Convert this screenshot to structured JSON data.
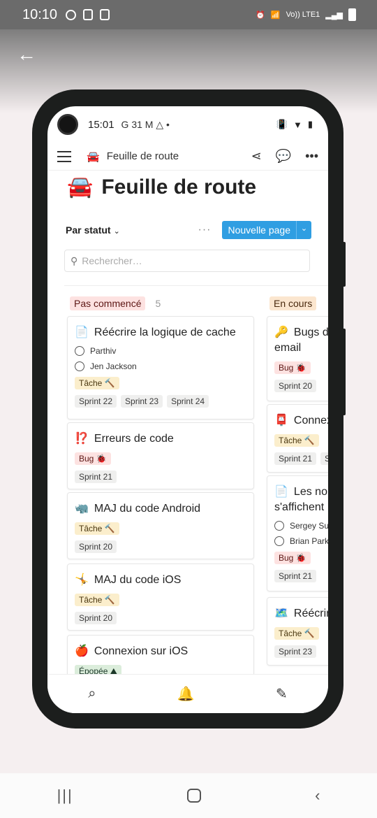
{
  "os_status": {
    "time": "10:10",
    "network": "Vo)) LTE1"
  },
  "app_status": {
    "time": "15:01",
    "icons": "G 31 M △ •"
  },
  "app_bar": {
    "emoji": "🚘",
    "title": "Feuille de route"
  },
  "page": {
    "emoji": "🚘",
    "title": "Feuille de route"
  },
  "toolbar": {
    "group_label": "Par statut",
    "more": "···",
    "new_page": "Nouvelle page"
  },
  "search": {
    "placeholder": "Rechercher…"
  },
  "columns": [
    {
      "label": "Pas commencé",
      "count": "5"
    },
    {
      "label": "En cours"
    }
  ],
  "cards_left": [
    {
      "icon": "📄",
      "title": "Réécrire la logique de cache",
      "people": [
        "Parthiv",
        "Jen Jackson"
      ],
      "type": "Tâche 🔨",
      "sprints": [
        "Sprint 22",
        "Sprint 23",
        "Sprint 24"
      ]
    },
    {
      "icon": "⁉️",
      "title": "Erreurs de code",
      "type": "Bug 🐞",
      "sprints": [
        "Sprint 21"
      ]
    },
    {
      "icon": "🦏",
      "title": "MAJ du code Android",
      "type": "Tâche 🔨",
      "sprints": [
        "Sprint 20"
      ]
    },
    {
      "icon": "🤸",
      "title": "MAJ du code iOS",
      "type": "Tâche 🔨",
      "sprints": [
        "Sprint 20"
      ]
    },
    {
      "icon": "🍎",
      "title": "Connexion sur iOS",
      "type": "Épopée ⛰"
    }
  ],
  "cards_right": [
    {
      "icon": "🔑",
      "title_line1": "Bugs d",
      "title_line2": "email",
      "type": "Bug 🐞",
      "sprint": "Sprint 20"
    },
    {
      "icon": "📮",
      "title": "Connex",
      "type": "Tâche 🔨",
      "sprint": "Sprint 21",
      "extra": "S"
    },
    {
      "icon": "📄",
      "title_line1": "Les no",
      "title_line2": "s'affichent",
      "people": [
        "Sergey Su",
        "Brian Park"
      ],
      "type": "Bug 🐞",
      "sprint": "Sprint 21"
    },
    {
      "icon": "🗺️",
      "title": "Réécrir",
      "type": "Tâche 🔨",
      "sprint": "Sprint 23"
    }
  ],
  "bottom_nav": {
    "search": "⌕",
    "bell": "🔔",
    "compose": "✎"
  },
  "os_nav": {
    "recent": "|||",
    "back": "‹"
  },
  "colors": {
    "accent": "#2f9ee2",
    "frame": "#1c1e1d"
  }
}
